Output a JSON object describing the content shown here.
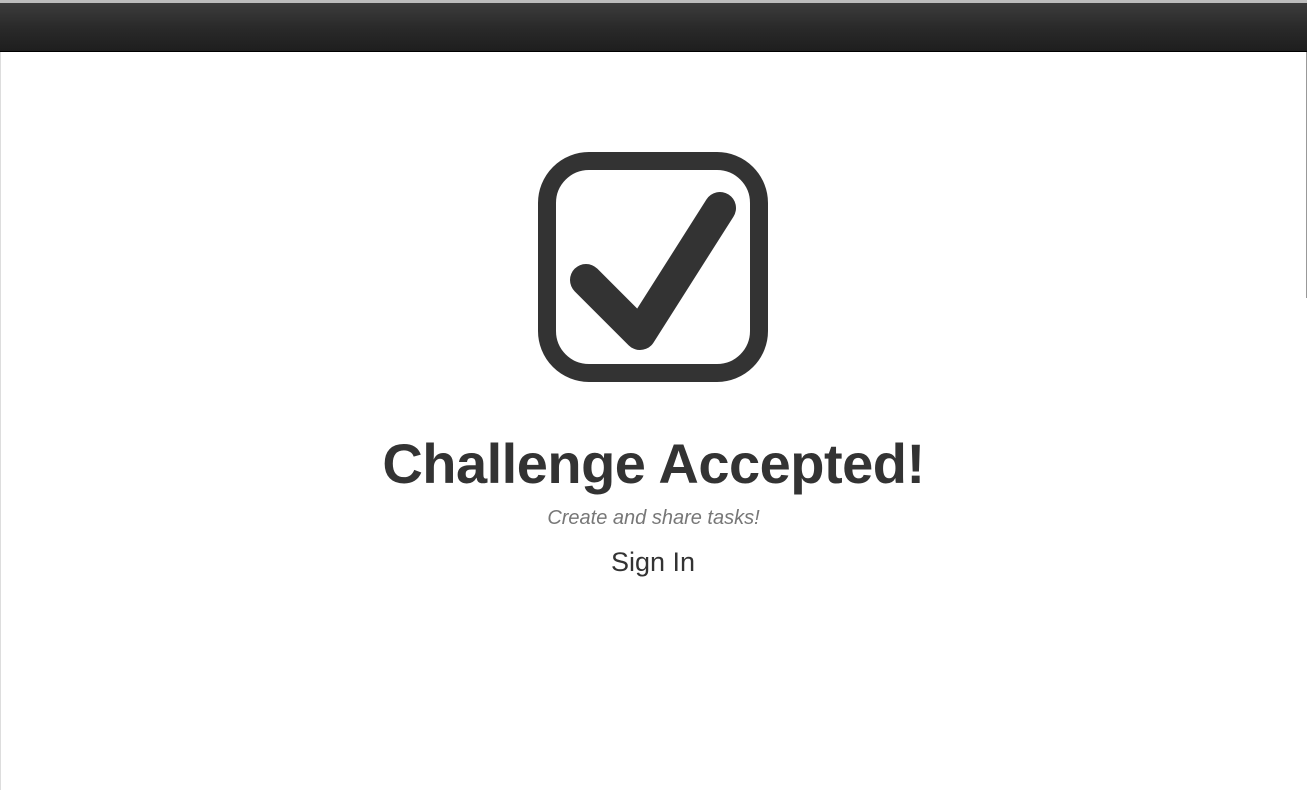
{
  "navbar": {
    "bg": "#222222"
  },
  "hero": {
    "logo_icon": "check-square-icon",
    "title": "Challenge Accepted!",
    "tagline": "Create and share tasks!",
    "signin_label": "Sign In",
    "text_color": "#333333",
    "tagline_color": "#777777"
  }
}
